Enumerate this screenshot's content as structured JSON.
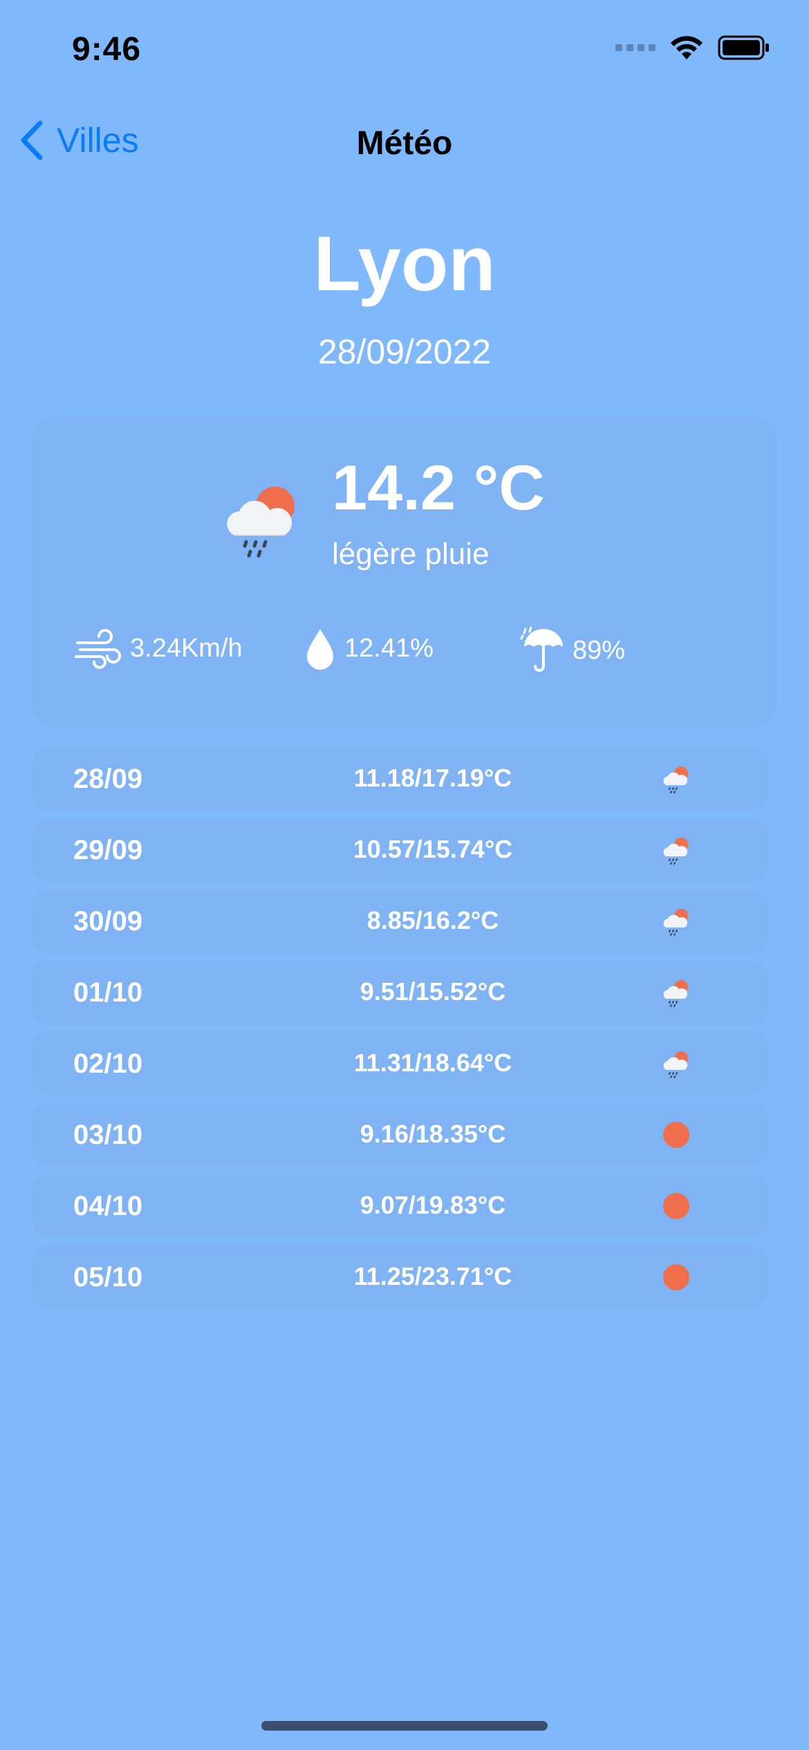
{
  "status_bar": {
    "time": "9:46",
    "icons": [
      "signal-dots-icon",
      "wifi-icon",
      "battery-icon"
    ]
  },
  "nav": {
    "back_label": "Villes",
    "title": "Météo"
  },
  "city": {
    "name": "Lyon",
    "date": "28/09/2022"
  },
  "current": {
    "temperature": "14.2 °C",
    "description": "légère pluie",
    "icon": "cloud-sun-rain-icon",
    "wind": "3.24Km/h",
    "humidity": "12.41%",
    "rain_chance": "89%"
  },
  "forecast": [
    {
      "date": "28/09",
      "temp": "11.18/17.19°C",
      "icon": "cloud-sun-rain-icon"
    },
    {
      "date": "29/09",
      "temp": "10.57/15.74°C",
      "icon": "cloud-sun-rain-icon"
    },
    {
      "date": "30/09",
      "temp": "8.85/16.2°C",
      "icon": "cloud-sun-rain-icon"
    },
    {
      "date": "01/10",
      "temp": "9.51/15.52°C",
      "icon": "cloud-sun-rain-icon"
    },
    {
      "date": "02/10",
      "temp": "11.31/18.64°C",
      "icon": "cloud-sun-rain-icon"
    },
    {
      "date": "03/10",
      "temp": "9.16/18.35°C",
      "icon": "sun-icon"
    },
    {
      "date": "04/10",
      "temp": "9.07/19.83°C",
      "icon": "sun-icon"
    },
    {
      "date": "05/10",
      "temp": "11.25/23.71°C",
      "icon": "sun-icon"
    }
  ],
  "colors": {
    "background": "#80b9fb",
    "card": "#7fb3f4",
    "accent": "#0a7cf5",
    "sun": "#ef6f4c"
  }
}
